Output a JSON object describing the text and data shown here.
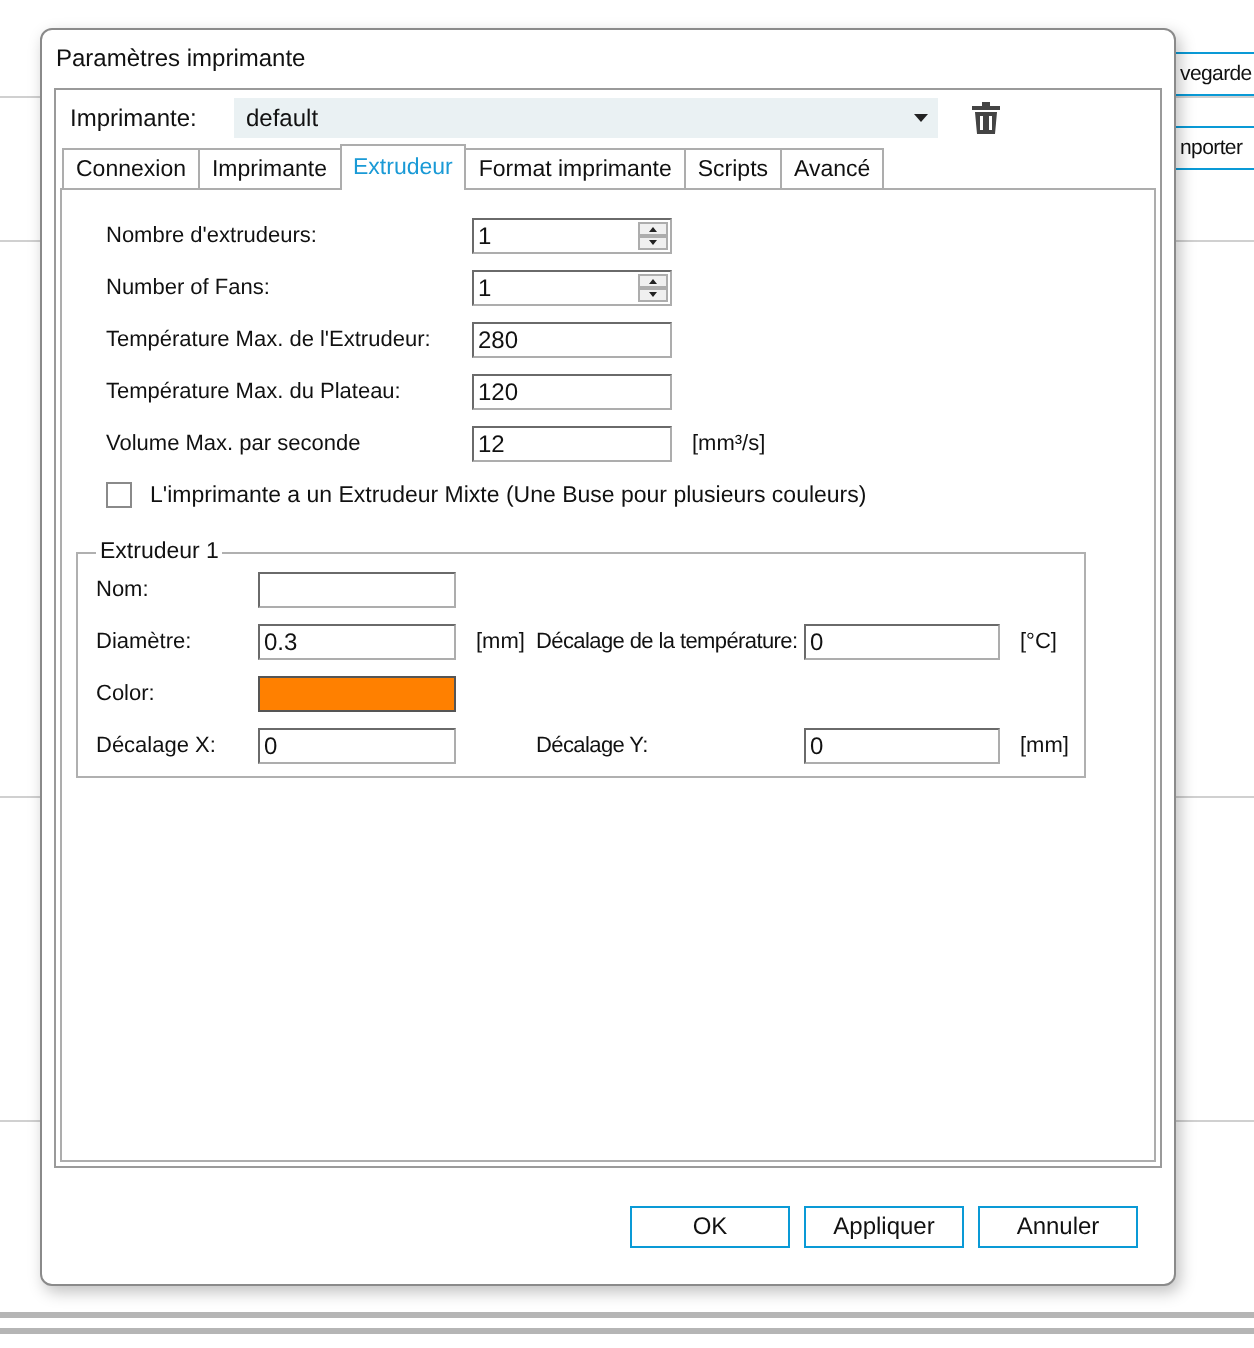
{
  "background": {
    "buttons": [
      {
        "label": "vegarde"
      },
      {
        "label": "nporter"
      }
    ]
  },
  "dialog": {
    "title": "Paramètres imprimante",
    "printer": {
      "label": "Imprimante:",
      "value": "default"
    },
    "tabs": [
      {
        "label": "Connexion",
        "selected": false
      },
      {
        "label": "Imprimante",
        "selected": false
      },
      {
        "label": "Extrudeur",
        "selected": true
      },
      {
        "label": "Format imprimante",
        "selected": false
      },
      {
        "label": "Scripts",
        "selected": false
      },
      {
        "label": "Avancé",
        "selected": false
      }
    ],
    "settings": [
      {
        "kind": "spinner",
        "label": "Nombre d'extrudeurs:",
        "value": "1"
      },
      {
        "kind": "spinner",
        "label": "Number of Fans:",
        "value": "1"
      },
      {
        "kind": "text",
        "label": "Température Max. de l'Extrudeur:",
        "value": "280"
      },
      {
        "kind": "text",
        "label": "Température Max. du Plateau:",
        "value": "120"
      },
      {
        "kind": "text",
        "label": "Volume Max. par seconde",
        "value": "12",
        "unit": "[mm³/s]"
      }
    ],
    "mixing": {
      "label": "L'imprimante a un Extrudeur Mixte (Une Buse pour plusieurs couleurs)",
      "checked": false
    },
    "extruder": {
      "title": "Extrudeur 1",
      "name": {
        "label": "Nom:"
      },
      "diameter": {
        "label": "Diamètre:",
        "value": "0.3",
        "unit": "[mm]"
      },
      "temp_offset": {
        "label": "Décalage de la température:",
        "value": "0",
        "unit": "[°C]"
      },
      "color": {
        "label": "Color:",
        "color": "#ff8000"
      },
      "offset_x": {
        "label": "Décalage X:",
        "value": "0"
      },
      "offset_y": {
        "label": "Décalage Y:",
        "value": "0",
        "unit": "[mm]"
      }
    },
    "buttons": [
      {
        "label": "OK"
      },
      {
        "label": "Appliquer"
      },
      {
        "label": "Annuler"
      }
    ]
  }
}
